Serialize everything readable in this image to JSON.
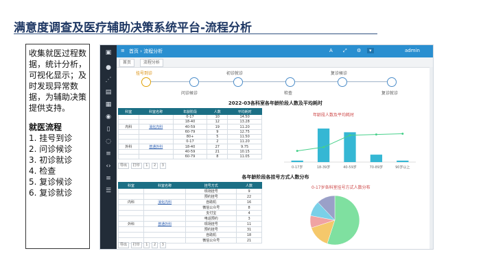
{
  "slide": {
    "title": "满意度调查及医疗辅助决策系统平台-流程分析",
    "description": "收集就医过程数据，统计分析，可视化显示；及时发现异常数据，为辅助决策提供支持。",
    "section_title": "就医流程",
    "steps": [
      "1. 挂号到诊",
      "2. 问诊候诊",
      "3. 初诊就诊",
      "4. 检查",
      "5. 复诊候诊",
      "6. 复诊就诊"
    ]
  },
  "app": {
    "topbar": {
      "breadcrumb": "首页 › 流程分析",
      "user": "admin"
    },
    "tabs": [
      "首页",
      "流程分析"
    ],
    "flow_labels": [
      "挂号到诊",
      "问诊候诊",
      "初诊就诊",
      "检查",
      "复诊候诊",
      "复诊就诊"
    ],
    "table1": {
      "heading": "2022-03各科室各年龄阶段人数及平均耗时",
      "headers": [
        "科室",
        "科室名称",
        "年龄阶段",
        "人数",
        "平均耗时"
      ],
      "rows": [
        [
          "",
          "",
          "0-17",
          "10",
          "14.50"
        ],
        [
          "",
          "",
          "18-40",
          "12",
          "13.28"
        ],
        [
          "内科",
          "消化内科",
          "40-59",
          "19",
          "11.20"
        ],
        [
          "",
          "",
          "60-79",
          "9",
          "12.75"
        ],
        [
          "",
          "",
          "80+",
          "5",
          "11.50"
        ],
        [
          "",
          "",
          "0-17",
          "2",
          "11.20"
        ],
        [
          "外科",
          "普通外科",
          "18-40",
          "27",
          "9.75"
        ],
        [
          "",
          "",
          "40-59",
          "21",
          "10.15"
        ],
        [
          "",
          "",
          "60-79",
          "8",
          "11.05"
        ]
      ],
      "pager": [
        "导出",
        "打印",
        "1",
        "2",
        "3"
      ]
    },
    "chart1": {
      "heading": "年龄段人数及平均耗时"
    },
    "table2": {
      "heading": "各年龄阶段各挂号方式人数分布",
      "headers": [
        "科室",
        "科室名称",
        "挂号方式",
        "人数"
      ],
      "rows": [
        [
          "",
          "",
          "现场挂号",
          "9"
        ],
        [
          "",
          "",
          "预约挂号",
          "22"
        ],
        [
          "内科",
          "消化内科",
          "自助机",
          "16"
        ],
        [
          "",
          "",
          "微信公众号",
          "8"
        ],
        [
          "",
          "",
          "支付宝",
          "4"
        ],
        [
          "",
          "",
          "电话预约",
          "3"
        ],
        [
          "外科",
          "普通外科",
          "现场挂号",
          "11"
        ],
        [
          "",
          "",
          "预约挂号",
          "31"
        ],
        [
          "",
          "",
          "自助机",
          "18"
        ],
        [
          "",
          "",
          "微信公众号",
          "21"
        ]
      ],
      "pager": [
        "导出",
        "打印",
        "1",
        "2",
        "3"
      ]
    },
    "chart2": {
      "heading": "0-17岁各科室挂号方式人数分布"
    }
  },
  "chart_data": [
    {
      "type": "bar",
      "title": "",
      "categories": [
        "0-17岁",
        "18-39岁",
        "40-59岁",
        "70-89岁",
        "90岁以上"
      ],
      "series": [
        {
          "values": [
            2,
            45,
            40,
            10,
            2
          ]
        },
        {
          "values": [
            15,
            20,
            36,
            37,
            38
          ]
        }
      ],
      "ylim": [
        0,
        55
      ],
      "colors": [
        "#35b7d4",
        "#46d08a"
      ]
    },
    {
      "type": "pie",
      "title": "",
      "values": [
        55,
        15,
        8,
        10,
        12
      ],
      "colors": [
        "#7fe0a0",
        "#f5c86b",
        "#f0a3a3",
        "#7ad0e8",
        "#9aa0c8"
      ]
    }
  ]
}
